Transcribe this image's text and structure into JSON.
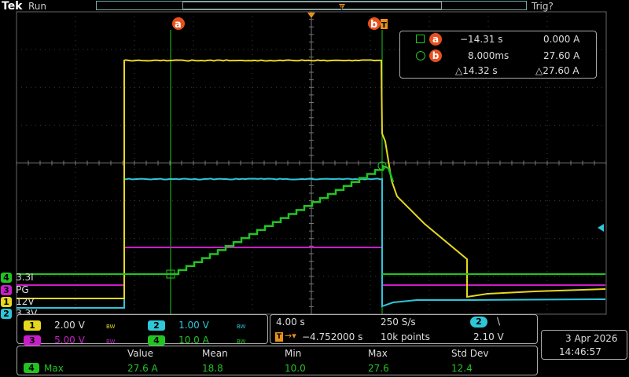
{
  "header": {
    "brand": "Tek",
    "run_state": "Run",
    "trigger_state": "Trig?"
  },
  "colors": {
    "ch1": "#e6d81e",
    "ch2": "#2fc6d8",
    "ch3": "#c81ec8",
    "ch4": "#22c322",
    "cursor": "#e8501e",
    "grid": "#555555",
    "trigger": "#e8901e"
  },
  "cursors": {
    "a_label": "a",
    "b_label": "b",
    "a_time": "−14.31 s",
    "a_value": "0.000 A",
    "b_time": "8.000ms",
    "b_value": "27.60 A",
    "delta_time": "△14.32 s",
    "delta_value": "△27.60 A"
  },
  "channel_labels": [
    {
      "num": "4",
      "name": "3.3I"
    },
    {
      "num": "3",
      "name": "PG"
    },
    {
      "num": "1",
      "name": "12V"
    },
    {
      "num": "2",
      "name": "3.3V"
    }
  ],
  "channel_settings": [
    {
      "num": "1",
      "scale": "2.00 V",
      "bw": "BW"
    },
    {
      "num": "2",
      "scale": "1.00 V",
      "bw": "BW"
    },
    {
      "num": "3",
      "scale": "5.00 V",
      "bw": "BW"
    },
    {
      "num": "4",
      "scale": "10.0 A",
      "bw": "BW"
    }
  ],
  "horizontal": {
    "scale": "4.00 s",
    "sample_rate": "250 S/s",
    "delay": "−4.752000 s",
    "record_length": "10k points"
  },
  "trigger": {
    "source": "2",
    "slope": "\\",
    "level": "2.10 V"
  },
  "datetime": {
    "date": "3 Apr  2026",
    "time": "14:46:57"
  },
  "measurement": {
    "headers": [
      "Value",
      "Mean",
      "Min",
      "Max",
      "Std Dev"
    ],
    "source": "4",
    "name": "Max",
    "values": [
      "27.6 A",
      "18.8",
      "10.0",
      "27.6",
      "12.4"
    ]
  }
}
